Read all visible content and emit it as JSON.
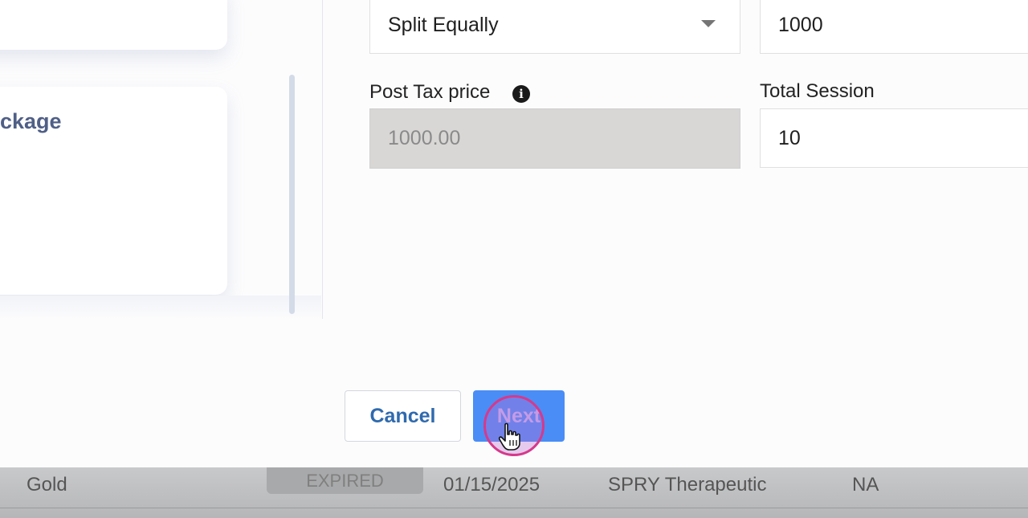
{
  "left_panel": {
    "package_card_title": "ckage"
  },
  "form": {
    "split_select": {
      "value": "Split Equally"
    },
    "price_input": {
      "value": "1000"
    },
    "post_tax": {
      "label": "Post Tax price",
      "value": "1000.00",
      "info_icon": "info-icon"
    },
    "total_session": {
      "label": "Total Session",
      "value": "10"
    }
  },
  "actions": {
    "cancel_label": "Cancel",
    "next_label": "Next"
  },
  "background_row": {
    "name": "Gold",
    "status": "EXPIRED",
    "date": "01/15/2025",
    "provider": "SPRY Therapeutic",
    "value": "NA"
  },
  "colors": {
    "accent_blue": "#4a8df6",
    "cancel_text": "#2f6aae",
    "click_indicator": "#d6398b",
    "card_title": "#4f5f86"
  }
}
